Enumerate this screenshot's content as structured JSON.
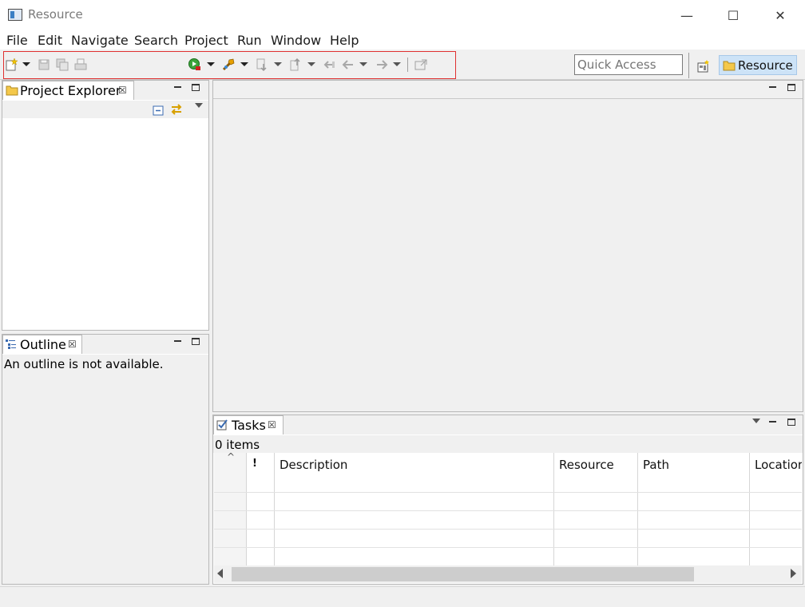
{
  "window": {
    "title": "Resource",
    "minimize_glyph": "—",
    "maximize_glyph": "☐",
    "close_glyph": "✕"
  },
  "menu": [
    "File",
    "Edit",
    "Navigate",
    "Search",
    "Project",
    "Run",
    "Window",
    "Help"
  ],
  "toolbar": {
    "quick_access_placeholder": "Quick Access",
    "perspective_label": "Resource",
    "highlight_color": "#e03030"
  },
  "project_explorer": {
    "title": "Project Explorer",
    "close_glyph": "☒"
  },
  "outline": {
    "title": "Outline",
    "close_glyph": "☒",
    "message": "An outline is not available."
  },
  "tasks": {
    "title": "Tasks",
    "close_glyph": "☒",
    "count": "0 items",
    "sort_glyph": "^",
    "columns": [
      "!",
      "Description",
      "Resource",
      "Path",
      "Locatior"
    ]
  },
  "colors": {
    "selected_perspective": "#cde3f7",
    "panel_background": "#ffffff",
    "chrome_background": "#f0f0f0"
  }
}
